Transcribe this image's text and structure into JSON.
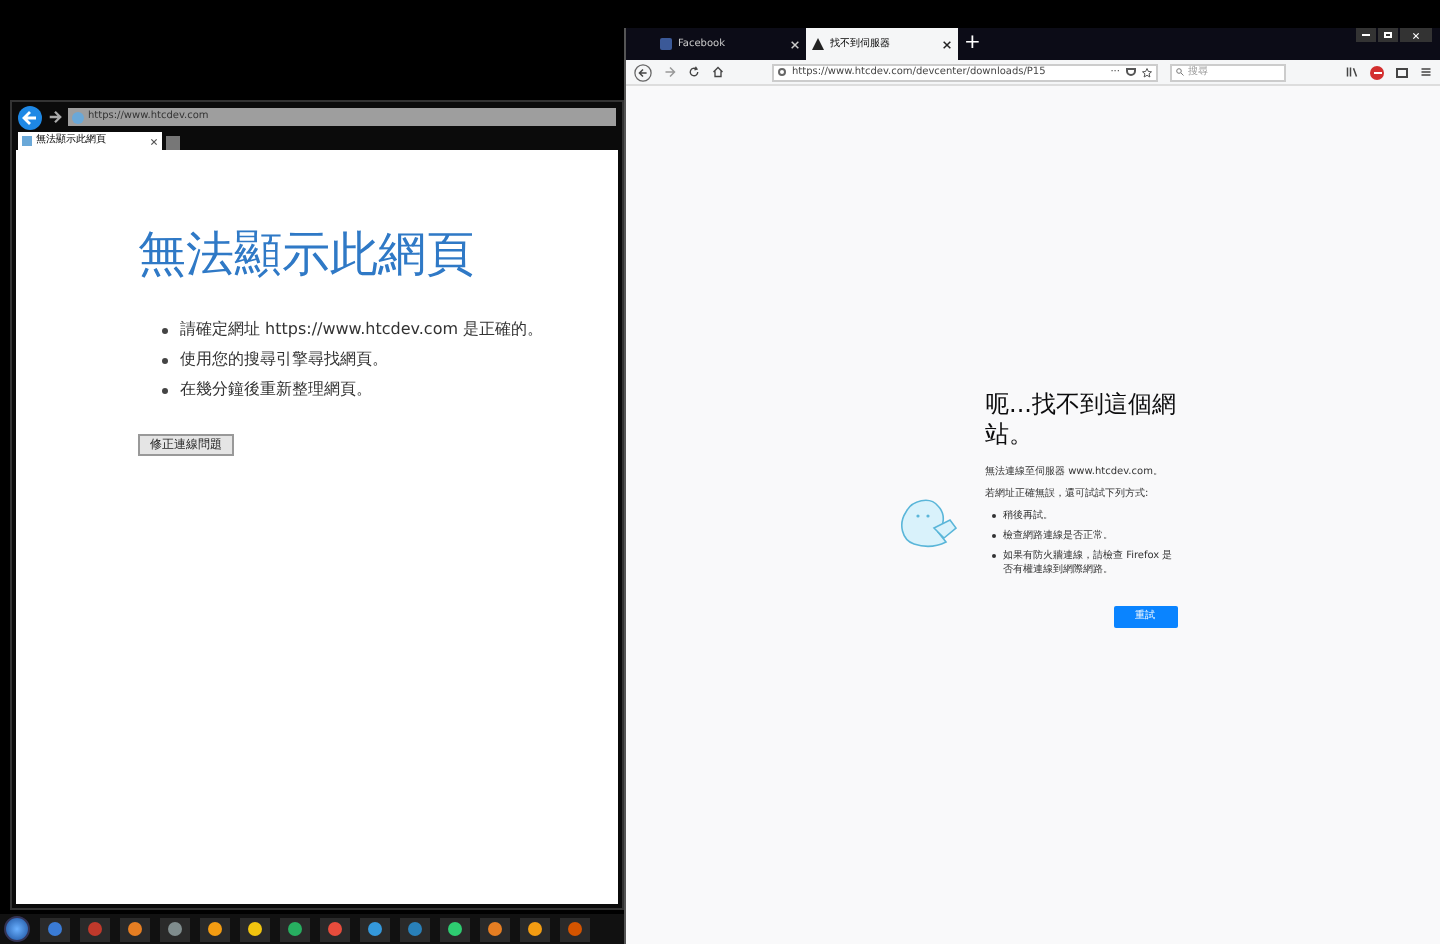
{
  "ie_window": {
    "address": "https://www.htcdev.com",
    "tabs": [
      {
        "label": "無法顯示此網頁",
        "selected": true
      }
    ],
    "heading": "無法顯示此網頁",
    "bullets": [
      "請確定網址 https://www.htcdev.com 是正確的。",
      "使用您的搜尋引擎尋找網頁。",
      "在幾分鐘後重新整理網頁。"
    ],
    "button": "修正連線問題"
  },
  "firefox_window": {
    "tabs": [
      {
        "label": "Facebook",
        "selected": false,
        "kind": "facebook"
      },
      {
        "label": "找不到伺服器",
        "selected": true,
        "kind": "warning"
      }
    ],
    "new_tab": "+",
    "address": "https://www.htcdev.com/devcenter/downloads/P15",
    "more": "···",
    "search": {
      "placeholder": "搜尋"
    },
    "heading": "呃...找不到這個網站。",
    "message": "無法連線至伺服器 www.htcdev.com。",
    "hint": "若網址正確無誤，還可試試下列方式:",
    "bullets": [
      "稍後再試。",
      "檢查網路連線是否正常。",
      "如果有防火牆連線，請檢查 Firefox 是否有權連線到網際網路。"
    ],
    "button": "重試"
  }
}
